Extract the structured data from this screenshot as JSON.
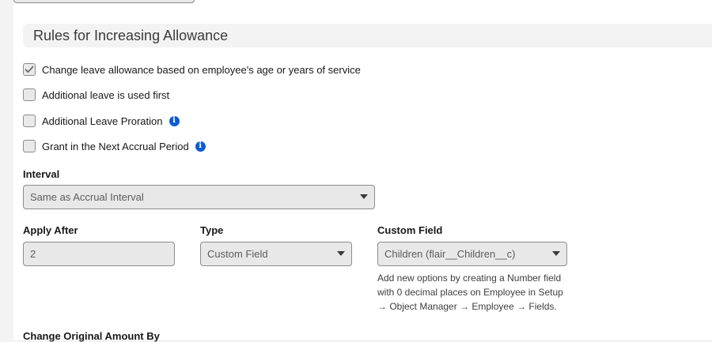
{
  "section": {
    "title": "Rules for Increasing Allowance"
  },
  "checkboxes": [
    {
      "label": "Change leave allowance based on employee's age or years of service",
      "checked": true
    },
    {
      "label": "Additional leave is used first",
      "checked": false
    },
    {
      "label": "Additional Leave Proration",
      "checked": false
    },
    {
      "label": "Grant in the Next Accrual Period",
      "checked": false
    }
  ],
  "icons": {
    "info": "info-icon",
    "dropdown": "chevron-down-icon",
    "check": "check-icon"
  },
  "interval": {
    "label": "Interval",
    "value": "Same as Accrual Interval"
  },
  "apply_after": {
    "label": "Apply After",
    "value": "2"
  },
  "type": {
    "label": "Type",
    "value": "Custom Field"
  },
  "custom_field": {
    "label": "Custom Field",
    "value": "Children (flair__Children__c)",
    "help": "Add new options by creating a Number field with 0 decimal places on Employee in Setup → Object Manager → Employee → Fields."
  },
  "change_original": {
    "label": "Change Original Amount By"
  },
  "colors": {
    "info": "#0b5cd5",
    "section_bg": "#f3f3f3",
    "field_bg": "#e8e8e8"
  }
}
